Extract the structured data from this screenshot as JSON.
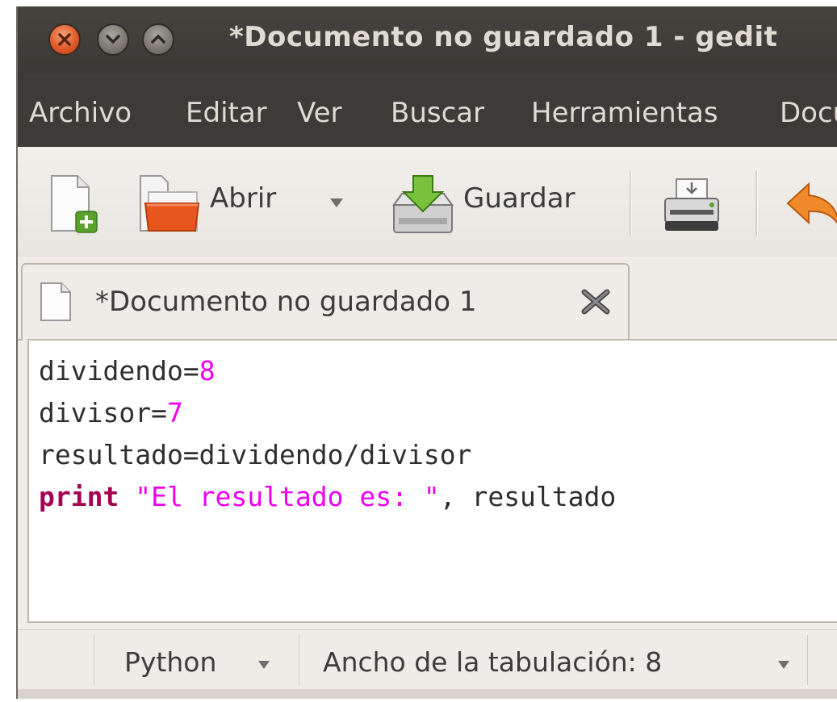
{
  "window": {
    "title": "*Documento no guardado 1 - gedit"
  },
  "menubar": {
    "items": [
      "Archivo",
      "Editar",
      "Ver",
      "Buscar",
      "Herramientas",
      "Documentos"
    ]
  },
  "toolbar": {
    "new_icon": "new-document-icon",
    "open_label": "Abrir",
    "open_icon": "open-folder-icon",
    "open_dropdown_icon": "chevron-down-icon",
    "save_label": "Guardar",
    "save_icon": "save-disk-icon",
    "print_icon": "printer-icon",
    "undo_icon": "undo-arrow-icon"
  },
  "tabs": [
    {
      "label": "*Documento no guardado 1",
      "icon": "document-icon",
      "close_icon": "close-x-icon"
    }
  ],
  "editor": {
    "language": "Python",
    "lines": [
      {
        "ident": "dividendo",
        "op": "=",
        "num": "8"
      },
      {
        "ident": "divisor",
        "op": "=",
        "num": "7"
      },
      {
        "text": "resultado=dividendo/divisor"
      },
      {
        "keyword": "print",
        "string": "\"El resultado es: \"",
        "rest": ", resultado"
      }
    ]
  },
  "statusbar": {
    "language_label": "Python",
    "tab_width_label": "Ancho de la tabulación: 8"
  },
  "colors": {
    "titlebar": "#3c3b37",
    "keyword": "#a50050",
    "number_string": "#ee00ee"
  }
}
